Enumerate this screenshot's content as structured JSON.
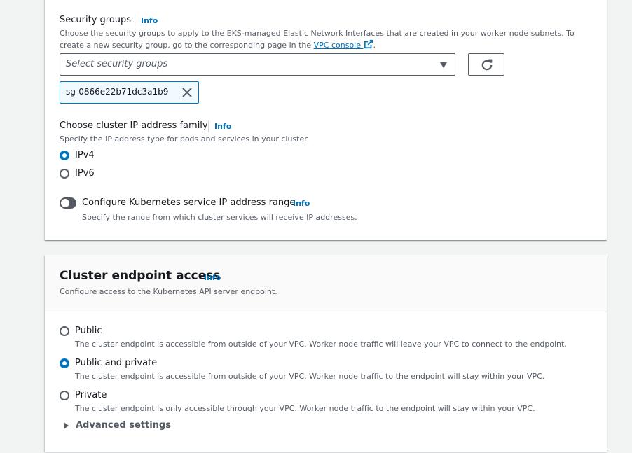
{
  "security_groups": {
    "label": "Security groups",
    "info": "Info",
    "description_part1": "Choose the security groups to apply to the EKS-managed Elastic Network Interfaces that are created in your worker node subnets. To create a new security group, go to the corresponding page in the ",
    "link_text": "VPC console",
    "description_end": ".",
    "placeholder": "Select security groups",
    "selected_token": "sg-0866e22b71dc3a1b9"
  },
  "ip_family": {
    "label": "Choose cluster IP address family",
    "info": "Info",
    "description": "Specify the IP address type for pods and services in your cluster.",
    "options": [
      {
        "label": "IPv4",
        "checked": true
      },
      {
        "label": "IPv6",
        "checked": false
      }
    ]
  },
  "service_range": {
    "label": "Configure Kubernetes service IP address range",
    "info": "Info",
    "description": "Specify the range from which cluster services will receive IP addresses.",
    "enabled": false
  },
  "endpoint_access": {
    "title": "Cluster endpoint access",
    "info": "Info",
    "description": "Configure access to the Kubernetes API server endpoint.",
    "options": [
      {
        "label": "Public",
        "description": "The cluster endpoint is accessible from outside of your VPC. Worker node traffic will leave your VPC to connect to the endpoint.",
        "checked": false
      },
      {
        "label": "Public and private",
        "description": "The cluster endpoint is accessible from outside of your VPC. Worker node traffic to the endpoint will stay within your VPC.",
        "checked": true
      },
      {
        "label": "Private",
        "description": "The cluster endpoint is only accessible through your VPC. Worker node traffic to the endpoint will stay within your VPC.",
        "checked": false
      }
    ],
    "advanced_label": "Advanced settings"
  },
  "colors": {
    "accent": "#0073bb",
    "text": "#16191f",
    "muted": "#545b64",
    "background": "#f2f3f3"
  },
  "icons": {
    "external_link": "external-link-icon",
    "refresh": "refresh-icon",
    "dismiss": "close-icon",
    "caret_down": "caret-down-icon",
    "caret_right": "caret-right-icon"
  }
}
